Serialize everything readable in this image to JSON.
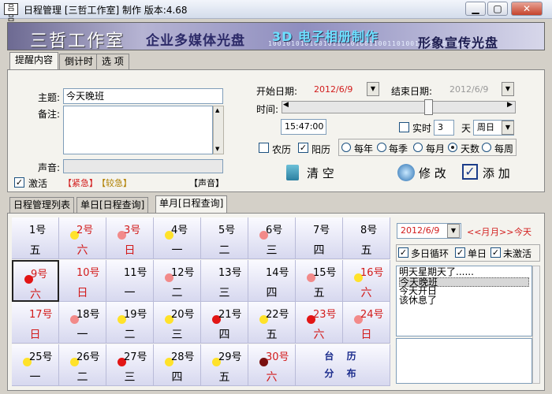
{
  "window": {
    "title": "日程管理 [三哲工作室] 制作 版本:4.68",
    "icon_text": "吕吕"
  },
  "banner": {
    "studio": "三哲工作室",
    "media": "企业多媒体光盘",
    "album": "3D 电子相册制作",
    "promo": "形象宣传光盘",
    "binary": "1001010101001011010100110011010010101100101001011"
  },
  "top_tabs": [
    "提醒内容",
    "倒计时",
    "选 项"
  ],
  "form": {
    "subject_label": "主题:",
    "subject_value": "今天晚班",
    "notes_label": "备注:",
    "sound_label": "声音:",
    "activate_label": "激活",
    "activate_checked": true,
    "urgent_tags": "【紧急】",
    "medium_tags": "【较急】",
    "sound_tag": "【声音】",
    "start_label": "开始日期:",
    "start_value": "2012/6/9",
    "end_label": "结束日期:",
    "end_value": "2012/6/9",
    "time_label": "时间:",
    "time_value": "15:47:00",
    "solid_label": "实时",
    "days_value": "3",
    "days_unit": "天",
    "repeat_value": "周日",
    "lunar_label": "农历",
    "solar_label": "阳历",
    "yearly": "每年",
    "seasonal": "每季",
    "monthly": "每月",
    "days": "天数",
    "weekly": "每周",
    "clear_button": "清 空",
    "edit_button": "修 改",
    "add_button": "添 加"
  },
  "bottom_tabs": [
    "日程管理列表",
    "单日[日程查询]",
    "单月[日程查询]"
  ],
  "calendar": {
    "distribution_top": "台 历",
    "distribution_bottom": "分 布",
    "cells": [
      {
        "d": "1号",
        "w": "五",
        "red": false,
        "dot": ""
      },
      {
        "d": "2号",
        "w": "六",
        "red": true,
        "dot": "#ffe22a"
      },
      {
        "d": "3号",
        "w": "日",
        "red": true,
        "dot": "#f28a8a"
      },
      {
        "d": "4号",
        "w": "一",
        "red": false,
        "dot": "#ffe22a"
      },
      {
        "d": "5号",
        "w": "二",
        "red": false,
        "dot": ""
      },
      {
        "d": "6号",
        "w": "三",
        "red": false,
        "dot": "#f28a8a"
      },
      {
        "d": "7号",
        "w": "四",
        "red": false,
        "dot": ""
      },
      {
        "d": "8号",
        "w": "五",
        "red": false,
        "dot": ""
      },
      {
        "d": "9号",
        "w": "六",
        "red": true,
        "dot": "#e21515",
        "sel": true
      },
      {
        "d": "10号",
        "w": "日",
        "red": true,
        "dot": ""
      },
      {
        "d": "11号",
        "w": "一",
        "red": false,
        "dot": ""
      },
      {
        "d": "12号",
        "w": "二",
        "red": false,
        "dot": "#f28a8a"
      },
      {
        "d": "13号",
        "w": "三",
        "red": false,
        "dot": ""
      },
      {
        "d": "14号",
        "w": "四",
        "red": false,
        "dot": ""
      },
      {
        "d": "15号",
        "w": "五",
        "red": false,
        "dot": "#f28a8a"
      },
      {
        "d": "16号",
        "w": "六",
        "red": true,
        "dot": "#ffe22a"
      },
      {
        "d": "17号",
        "w": "日",
        "red": true,
        "dot": ""
      },
      {
        "d": "18号",
        "w": "一",
        "red": false,
        "dot": "#f28a8a"
      },
      {
        "d": "19号",
        "w": "二",
        "red": false,
        "dot": "#ffe22a"
      },
      {
        "d": "20号",
        "w": "三",
        "red": false,
        "dot": "#ffe22a"
      },
      {
        "d": "21号",
        "w": "四",
        "red": false,
        "dot": "#e21515"
      },
      {
        "d": "22号",
        "w": "五",
        "red": false,
        "dot": "#ffe22a"
      },
      {
        "d": "23号",
        "w": "六",
        "red": true,
        "dot": "#e21515"
      },
      {
        "d": "24号",
        "w": "日",
        "red": true,
        "dot": "#f28a8a"
      },
      {
        "d": "25号",
        "w": "一",
        "red": false,
        "dot": "#ffe22a"
      },
      {
        "d": "26号",
        "w": "二",
        "red": false,
        "dot": "#ffe22a"
      },
      {
        "d": "27号",
        "w": "三",
        "red": false,
        "dot": "#e21515"
      },
      {
        "d": "28号",
        "w": "四",
        "red": false,
        "dot": "#ffe22a"
      },
      {
        "d": "29号",
        "w": "五",
        "red": false,
        "dot": "#ffe22a"
      },
      {
        "d": "30号",
        "w": "六",
        "red": true,
        "dot": "#7a1010"
      }
    ]
  },
  "side": {
    "date_value": "2012/6/9",
    "prev_month": "<<月",
    "next_month": "月>>",
    "today": "今天",
    "multi_loop": "多日循环",
    "single_day": "单日",
    "inactive": "未激活",
    "list": [
      "明天星期天了......",
      "今天晚班",
      "今天开日",
      "该休息了"
    ]
  }
}
